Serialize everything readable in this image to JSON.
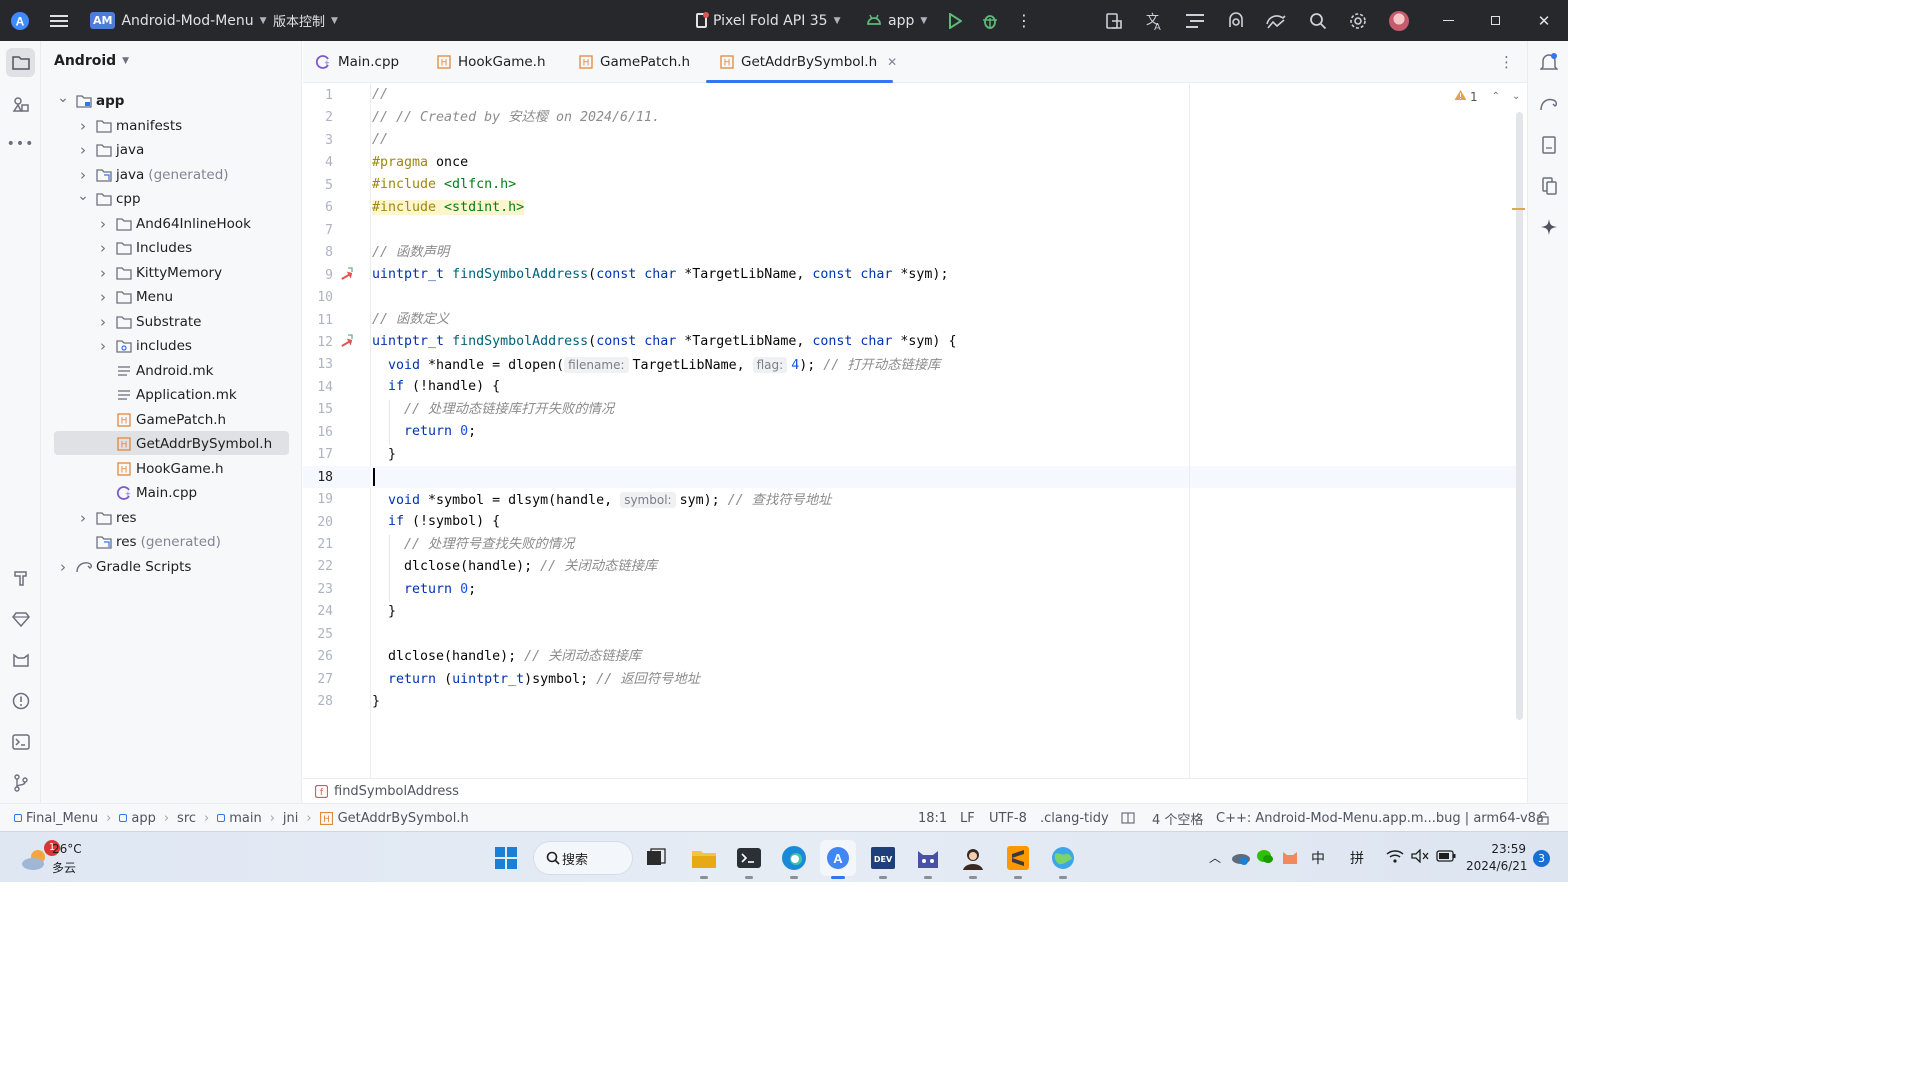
{
  "titlebar": {
    "app_logo_letter": "A",
    "project_badge": "AM",
    "project_name": "Android-Mod-Menu",
    "vcs_menu": "版本控制",
    "device": "Pixel Fold API 35",
    "run_config": "app"
  },
  "project_panel": {
    "view_mode": "Android",
    "tree": [
      {
        "label": "app",
        "depth": 0,
        "expanded": true,
        "icon": "module-folder-icon"
      },
      {
        "label": "manifests",
        "depth": 1,
        "expanded": false,
        "icon": "folder-icon"
      },
      {
        "label": "java",
        "depth": 1,
        "expanded": false,
        "icon": "folder-icon"
      },
      {
        "label": "java",
        "suffix": "(generated)",
        "depth": 1,
        "expanded": false,
        "icon": "generated-folder-icon"
      },
      {
        "label": "cpp",
        "depth": 1,
        "expanded": true,
        "icon": "folder-icon"
      },
      {
        "label": "And64InlineHook",
        "depth": 2,
        "expanded": false,
        "icon": "folder-icon"
      },
      {
        "label": "Includes",
        "depth": 2,
        "expanded": false,
        "icon": "folder-icon"
      },
      {
        "label": "KittyMemory",
        "depth": 2,
        "expanded": false,
        "icon": "folder-icon"
      },
      {
        "label": "Menu",
        "depth": 2,
        "expanded": false,
        "icon": "folder-icon"
      },
      {
        "label": "Substrate",
        "depth": 2,
        "expanded": false,
        "icon": "folder-icon"
      },
      {
        "label": "includes",
        "depth": 2,
        "expanded": false,
        "icon": "include-folder-icon"
      },
      {
        "label": "Android.mk",
        "depth": 2,
        "icon": "text-file-icon"
      },
      {
        "label": "Application.mk",
        "depth": 2,
        "icon": "text-file-icon"
      },
      {
        "label": "GamePatch.h",
        "depth": 2,
        "icon": "header-file-icon"
      },
      {
        "label": "GetAddrBySymbol.h",
        "depth": 2,
        "icon": "header-file-icon",
        "selected": true
      },
      {
        "label": "HookGame.h",
        "depth": 2,
        "icon": "header-file-icon"
      },
      {
        "label": "Main.cpp",
        "depth": 2,
        "icon": "cpp-file-icon"
      },
      {
        "label": "res",
        "depth": 1,
        "expanded": false,
        "icon": "folder-icon"
      },
      {
        "label": "res",
        "suffix": "(generated)",
        "depth": 1,
        "icon": "generated-folder-icon"
      },
      {
        "label": "Gradle Scripts",
        "depth": 0,
        "expanded": false,
        "icon": "gradle-icon"
      }
    ]
  },
  "tabs": [
    {
      "label": "Main.cpp",
      "icon": "cpp-file-icon"
    },
    {
      "label": "HookGame.h",
      "icon": "header-file-icon"
    },
    {
      "label": "GamePatch.h",
      "icon": "header-file-icon"
    },
    {
      "label": "GetAddrBySymbol.h",
      "icon": "header-file-icon",
      "active": true
    }
  ],
  "editor": {
    "warning_count": "1",
    "line_numbers": [
      "1",
      "2",
      "3",
      "4",
      "5",
      "6",
      "7",
      "8",
      "9",
      "10",
      "11",
      "12",
      "13",
      "14",
      "15",
      "16",
      "17",
      "18",
      "19",
      "20",
      "21",
      "22",
      "23",
      "24",
      "25",
      "26",
      "27",
      "28"
    ],
    "hints": {
      "filename": "filename:",
      "flag": "flag:",
      "symbol": "symbol:"
    },
    "lines": {
      "l1": "//",
      "l2": "// // Created by 安达樱 on 2024/6/11.",
      "l3": "//",
      "l4_a": "#pragma",
      "l4_b": " once",
      "l5_a": "#include",
      "l5_b": " <dlfcn.h>",
      "l6_a": "#include",
      "l6_b": " <stdint.h>",
      "l8": "// 函数声明",
      "l9_type": "uintptr_t",
      "l9_fn": "findSymbolAddress",
      "l9_p1": "(",
      "l9_kw1": "const char",
      "l9_p2": " *TargetLibName, ",
      "l9_kw2": "const char",
      "l9_p3": " *sym);",
      "l11": "// 函数定义",
      "l12_type": "uintptr_t",
      "l12_fn": "findSymbolAddress",
      "l12_p1": "(",
      "l12_kw1": "const char",
      "l12_p2": " *TargetLibName, ",
      "l12_kw2": "const char",
      "l12_p3": " *sym) {",
      "l13_kw": "void",
      "l13_a": " *handle = dlopen(",
      "l13_b": "TargetLibName, ",
      "l13_num": "4",
      "l13_c": "); ",
      "l13_cm": "// 打开动态链接库",
      "l14_kw": "if",
      "l14_a": " (!handle) {",
      "l15": "// 处理动态链接库打开失败的情况",
      "l16_kw": "return",
      "l16_num": "0",
      "l16_a": ";",
      "l17": "}",
      "l19_kw": "void",
      "l19_a": " *symbol = dlsym(handle, ",
      "l19_b": "sym); ",
      "l19_cm": "// 查找符号地址",
      "l20_kw": "if",
      "l20_a": " (!symbol) {",
      "l21": "// 处理符号查找失败的情况",
      "l22_a": "dlclose(handle); ",
      "l22_cm": "// 关闭动态链接库",
      "l23_kw": "return",
      "l23_num": "0",
      "l23_a": ";",
      "l24": "}",
      "l26_a": "dlclose(handle); ",
      "l26_cm": "// 关闭动态链接库",
      "l27_kw": "return",
      "l27_a": " (",
      "l27_type": "uintptr_t",
      "l27_b": ")symbol; ",
      "l27_cm": "// 返回符号地址",
      "l28": "}"
    },
    "function_breadcrumb": "findSymbolAddress"
  },
  "statusbar": {
    "path": [
      "Final_Menu",
      "app",
      "src",
      "main",
      "jni",
      "GetAddrBySymbol.h"
    ],
    "position": "18:1",
    "line_sep": "LF",
    "encoding": "UTF-8",
    "linter": ".clang-tidy",
    "indent": "4 个空格",
    "context": "C++: Android-Mod-Menu.app.m...bug | arm64-v8a"
  },
  "taskbar": {
    "weather_temp": "26°C",
    "weather_desc": "多云",
    "weather_badge": "1",
    "search_label": "搜索",
    "ime_lang": "中",
    "ime_mode": "拼",
    "time": "23:59",
    "date": "2024/6/21",
    "notif_count": "3"
  },
  "colors": {
    "accent": "#3574f0",
    "titlebar_bg": "#27282c",
    "keyword": "#0033b3",
    "function": "#00627a",
    "comment": "#8c8c8c"
  }
}
